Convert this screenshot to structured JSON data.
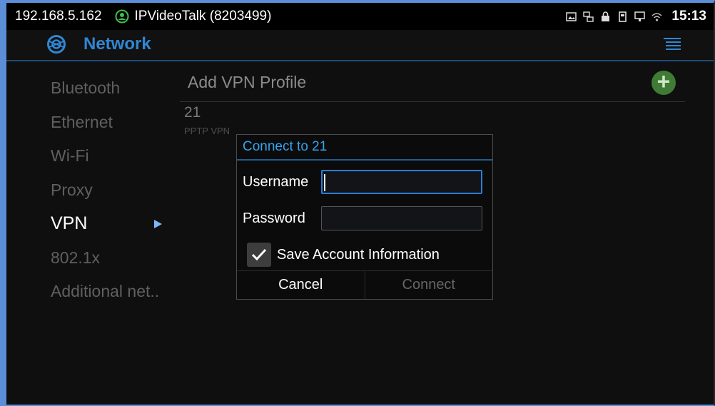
{
  "status_bar": {
    "ip": "192.168.5.162",
    "app_name": "IPVideoTalk (8203499)",
    "time": "15:13",
    "icons": [
      "image-icon",
      "network-adapter-icon",
      "lock-icon",
      "sd-card-icon",
      "ethernet-icon",
      "wifi-icon"
    ]
  },
  "app_bar": {
    "title": "Network",
    "icon": "network-globe-icon",
    "menu_icon": "menu-icon",
    "accent": "#2f87d4"
  },
  "sidebar": {
    "items": [
      {
        "label": "Bluetooth",
        "active": false
      },
      {
        "label": "Ethernet",
        "active": false
      },
      {
        "label": "Wi-Fi",
        "active": false
      },
      {
        "label": "Proxy",
        "active": false
      },
      {
        "label": "VPN",
        "active": true
      },
      {
        "label": "802.1x",
        "active": false
      },
      {
        "label": "Additional net.."
      }
    ]
  },
  "main": {
    "add_label": "Add VPN Profile",
    "add_icon": "plus-icon",
    "profile": {
      "name": "21",
      "type": "PPTP VPN"
    }
  },
  "dialog": {
    "title": "Connect to 21",
    "username_label": "Username",
    "username_value": "",
    "password_label": "Password",
    "password_value": "",
    "save_label": "Save Account Information",
    "save_checked": true,
    "cancel_label": "Cancel",
    "connect_label": "Connect"
  }
}
